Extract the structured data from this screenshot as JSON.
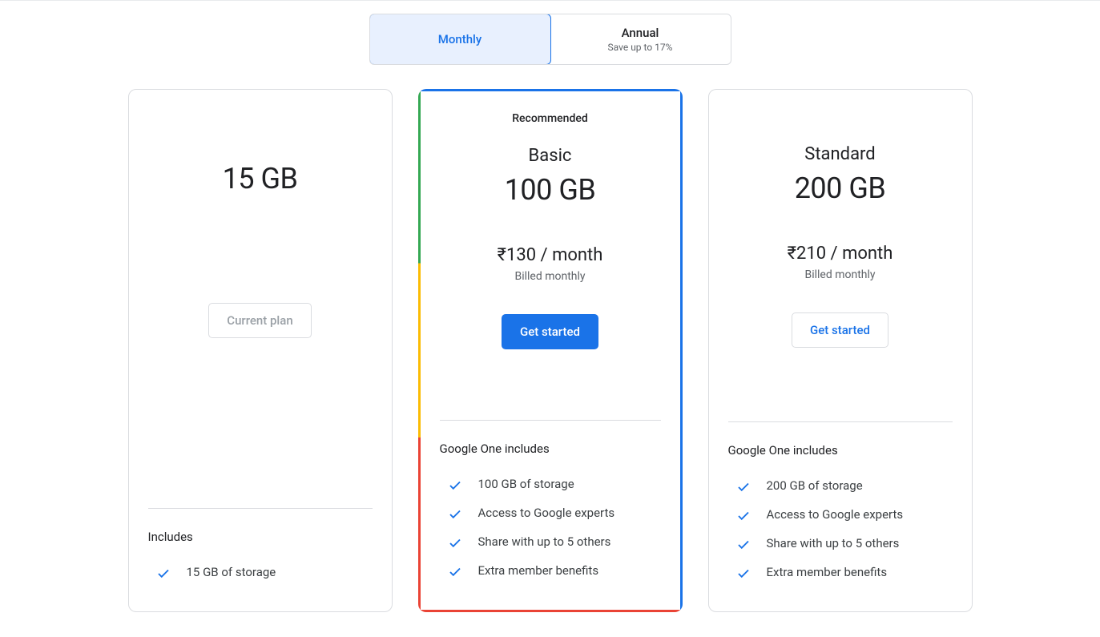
{
  "toggle": {
    "monthly": "Monthly",
    "annual": "Annual",
    "annual_sub": "Save up to 17%"
  },
  "plans": [
    {
      "badge": "",
      "name": "",
      "storage": "15 GB",
      "price": "",
      "billed": "",
      "cta": "Current plan",
      "includes_label": "Includes",
      "features": [
        "15 GB of storage"
      ]
    },
    {
      "badge": "Recommended",
      "name": "Basic",
      "storage": "100 GB",
      "price": "₹130 / month",
      "billed": "Billed monthly",
      "cta": "Get started",
      "includes_label": "Google One includes",
      "features": [
        "100 GB of storage",
        "Access to Google experts",
        "Share with up to 5 others",
        "Extra member benefits"
      ]
    },
    {
      "badge": "",
      "name": "Standard",
      "storage": "200 GB",
      "price": "₹210 / month",
      "billed": "Billed monthly",
      "cta": "Get started",
      "includes_label": "Google One includes",
      "features": [
        "200 GB of storage",
        "Access to Google experts",
        "Share with up to 5 others",
        "Extra member benefits"
      ]
    }
  ]
}
